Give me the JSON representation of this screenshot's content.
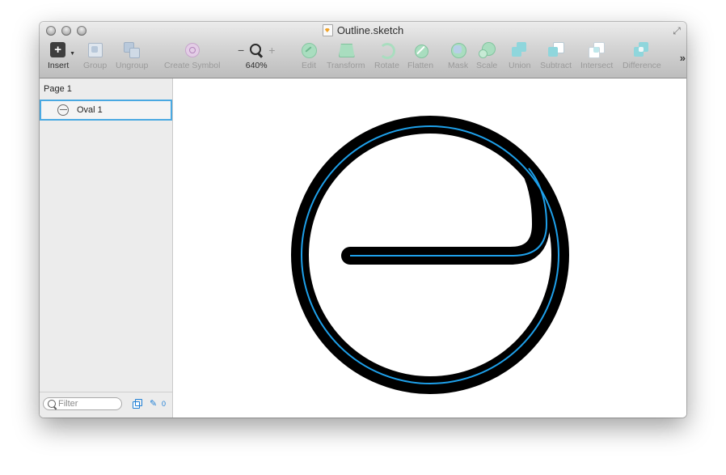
{
  "window": {
    "title": "Outline.sketch",
    "fullscreen_glyph": "⤢"
  },
  "toolbar": {
    "insert": "Insert",
    "group": "Group",
    "ungroup": "Ungroup",
    "create_symbol": "Create Symbol",
    "zoom_level": "640%",
    "zoom_out": "−",
    "zoom_in": "+",
    "edit": "Edit",
    "transform": "Transform",
    "rotate": "Rotate",
    "flatten": "Flatten",
    "mask": "Mask",
    "scale": "Scale",
    "union": "Union",
    "subtract": "Subtract",
    "intersect": "Intersect",
    "difference": "Difference",
    "more": "»"
  },
  "sidebar": {
    "page": "Page 1",
    "layers": [
      {
        "name": "Oval 1",
        "selected": true
      }
    ],
    "filter_placeholder": "Filter",
    "slice_count": "0"
  },
  "colors": {
    "selection": "#4aa9e2",
    "outline_path": "#1ea0ea",
    "stroke": "#000000"
  }
}
